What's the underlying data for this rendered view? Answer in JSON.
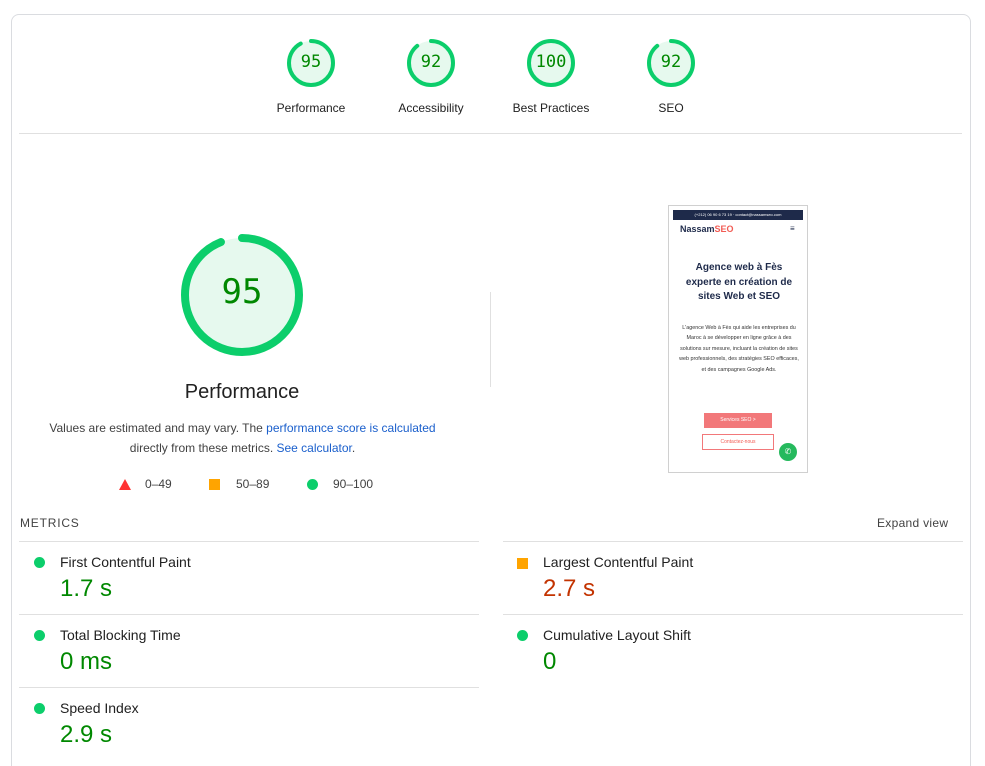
{
  "categories": [
    {
      "score": "95",
      "label": "Performance",
      "fraction": 0.95
    },
    {
      "score": "92",
      "label": "Accessibility",
      "fraction": 0.92
    },
    {
      "score": "100",
      "label": "Best Practices",
      "fraction": 1.0
    },
    {
      "score": "92",
      "label": "SEO",
      "fraction": 0.92
    }
  ],
  "main": {
    "score": "95",
    "fraction": 0.95,
    "title": "Performance",
    "desc_prefix": "Values are estimated and may vary. The ",
    "desc_link": "performance score is calculated",
    "desc_middle": " directly from these metrics. ",
    "desc_calc": "See calculator",
    "desc_end": "."
  },
  "legend": [
    {
      "shape": "triangle",
      "range": "0–49",
      "color": "#ff3333"
    },
    {
      "shape": "square",
      "range": "50–89",
      "color": "#ffa400"
    },
    {
      "shape": "circle",
      "range": "90–100",
      "color": "#0cce6b"
    }
  ],
  "thumbnail": {
    "topbar": "(+212) 06 90 6 73 19 · contact@nassamseo.com",
    "logo_a": "Nassam",
    "logo_b": "SEO",
    "heading": "Agence web à Fès experte en création de sites Web et SEO",
    "paragraph": "L'agence Web à Fès qui aide les entreprises du Maroc à se développer en ligne grâce à des solutions sur mesure, incluant la création de sites web professionnels, des stratégies SEO efficaces, et des campagnes Google Ads.",
    "button1": "Services SEO >",
    "button2": "Contactez-nous"
  },
  "metrics": {
    "heading": "METRICS",
    "expand": "Expand view",
    "items": [
      {
        "name": "First Contentful Paint",
        "value": "1.7 s",
        "status": "pass"
      },
      {
        "name": "Largest Contentful Paint",
        "value": "2.7 s",
        "status": "average"
      },
      {
        "name": "Total Blocking Time",
        "value": "0 ms",
        "status": "pass"
      },
      {
        "name": "Cumulative Layout Shift",
        "value": "0",
        "status": "pass"
      },
      {
        "name": "Speed Index",
        "value": "2.9 s",
        "status": "pass"
      }
    ]
  },
  "colors": {
    "pass": "#0cce6b",
    "pass_text": "#008800",
    "average": "#ffa400",
    "average_text": "#c33300"
  }
}
